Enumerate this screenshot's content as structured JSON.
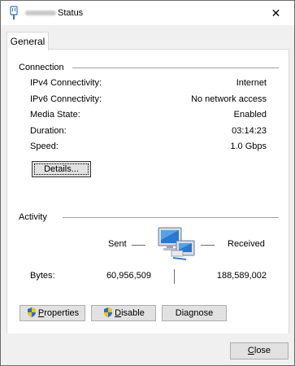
{
  "window": {
    "title": "Status",
    "close_glyph": "✕"
  },
  "tabs": [
    {
      "label": "General"
    }
  ],
  "connection": {
    "group_label": "Connection",
    "rows": [
      {
        "label": "IPv4 Connectivity:",
        "value": "Internet"
      },
      {
        "label": "IPv6 Connectivity:",
        "value": "No network access"
      },
      {
        "label": "Media State:",
        "value": "Enabled"
      },
      {
        "label": "Duration:",
        "value": "03:14:23"
      },
      {
        "label": "Speed:",
        "value": "1.0 Gbps"
      }
    ],
    "details_button": "Details..."
  },
  "activity": {
    "group_label": "Activity",
    "sent_label": "Sent",
    "received_label": "Received",
    "bytes_label": "Bytes:",
    "bytes_sent": "60,956,509",
    "bytes_received": "188,589,002"
  },
  "buttons": {
    "properties_first": "P",
    "properties_rest": "roperties",
    "disable_first": "D",
    "disable_rest": "isable",
    "diagnose": "Diagnose",
    "close_first": "C",
    "close_rest": "lose"
  },
  "icons": {
    "title": "ethernet-adapter-icon",
    "activity": "network-computers-icon",
    "shield": "uac-shield-icon"
  },
  "colors": {
    "window_bg": "#f0f0f0",
    "panel_bg": "#ffffff",
    "button_bg": "#e1e1e1",
    "monitor_blue": "#2a78d0"
  }
}
